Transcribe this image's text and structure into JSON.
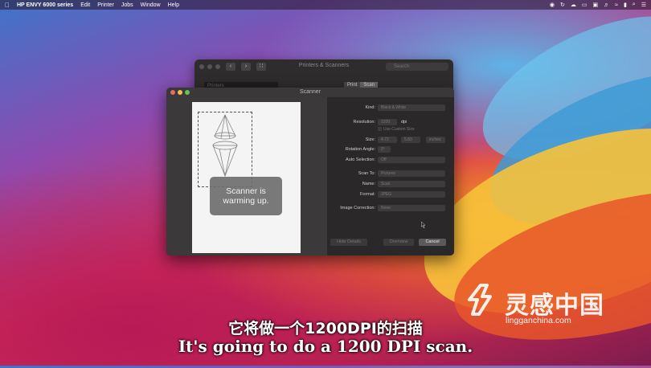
{
  "menubar": {
    "apple": "",
    "app_name": "HP ENVY 6000 series",
    "items": [
      "Edit",
      "Printer",
      "Jobs",
      "Window",
      "Help"
    ],
    "status_icons": [
      "camera-icon",
      "sync-icon",
      "cloud-icon",
      "display-icon",
      "vr-icon",
      "volume-icon",
      "wifi-icon",
      "battery-icon",
      "search-icon",
      "control-center-icon"
    ]
  },
  "printers_window": {
    "title": "Printers & Scanners",
    "search_placeholder": "Search",
    "list_header": "Printers",
    "tabs": [
      "Print",
      "Scan"
    ],
    "active_tab": "Scan"
  },
  "scanner_window": {
    "title": "Scanner",
    "status_overlay_line1": "Scanner is",
    "status_overlay_line2": "warming up.",
    "fields": {
      "kind_label": "Kind:",
      "kind_value": "Black & White",
      "resolution_label": "Resolution:",
      "resolution_value": "1200",
      "resolution_unit": "dpi",
      "custom_size_label": "Use Custom Size",
      "size_label": "Size:",
      "size_w": "4.72",
      "size_h": "5.83",
      "size_unit": "inches",
      "rotation_label": "Rotation Angle:",
      "rotation_value": "0°",
      "auto_sel_label": "Auto Selection:",
      "auto_sel_value": "Off",
      "scan_to_label": "Scan To:",
      "scan_to_value": "Pictures",
      "name_label": "Name:",
      "name_value": "Scan",
      "format_label": "Format:",
      "format_value": "JPEG",
      "image_correction_label": "Image Correction:",
      "image_correction_value": "None"
    },
    "buttons": {
      "hide_details": "Hide Details",
      "overview": "Overview",
      "cancel": "Cancel"
    }
  },
  "subtitles": {
    "chinese": "它将做一个1200DPI的扫描",
    "english": "It's going to do a 1200 DPI scan."
  },
  "watermark": {
    "brand_cn": "灵感中国",
    "url": "lingganchina.com"
  }
}
